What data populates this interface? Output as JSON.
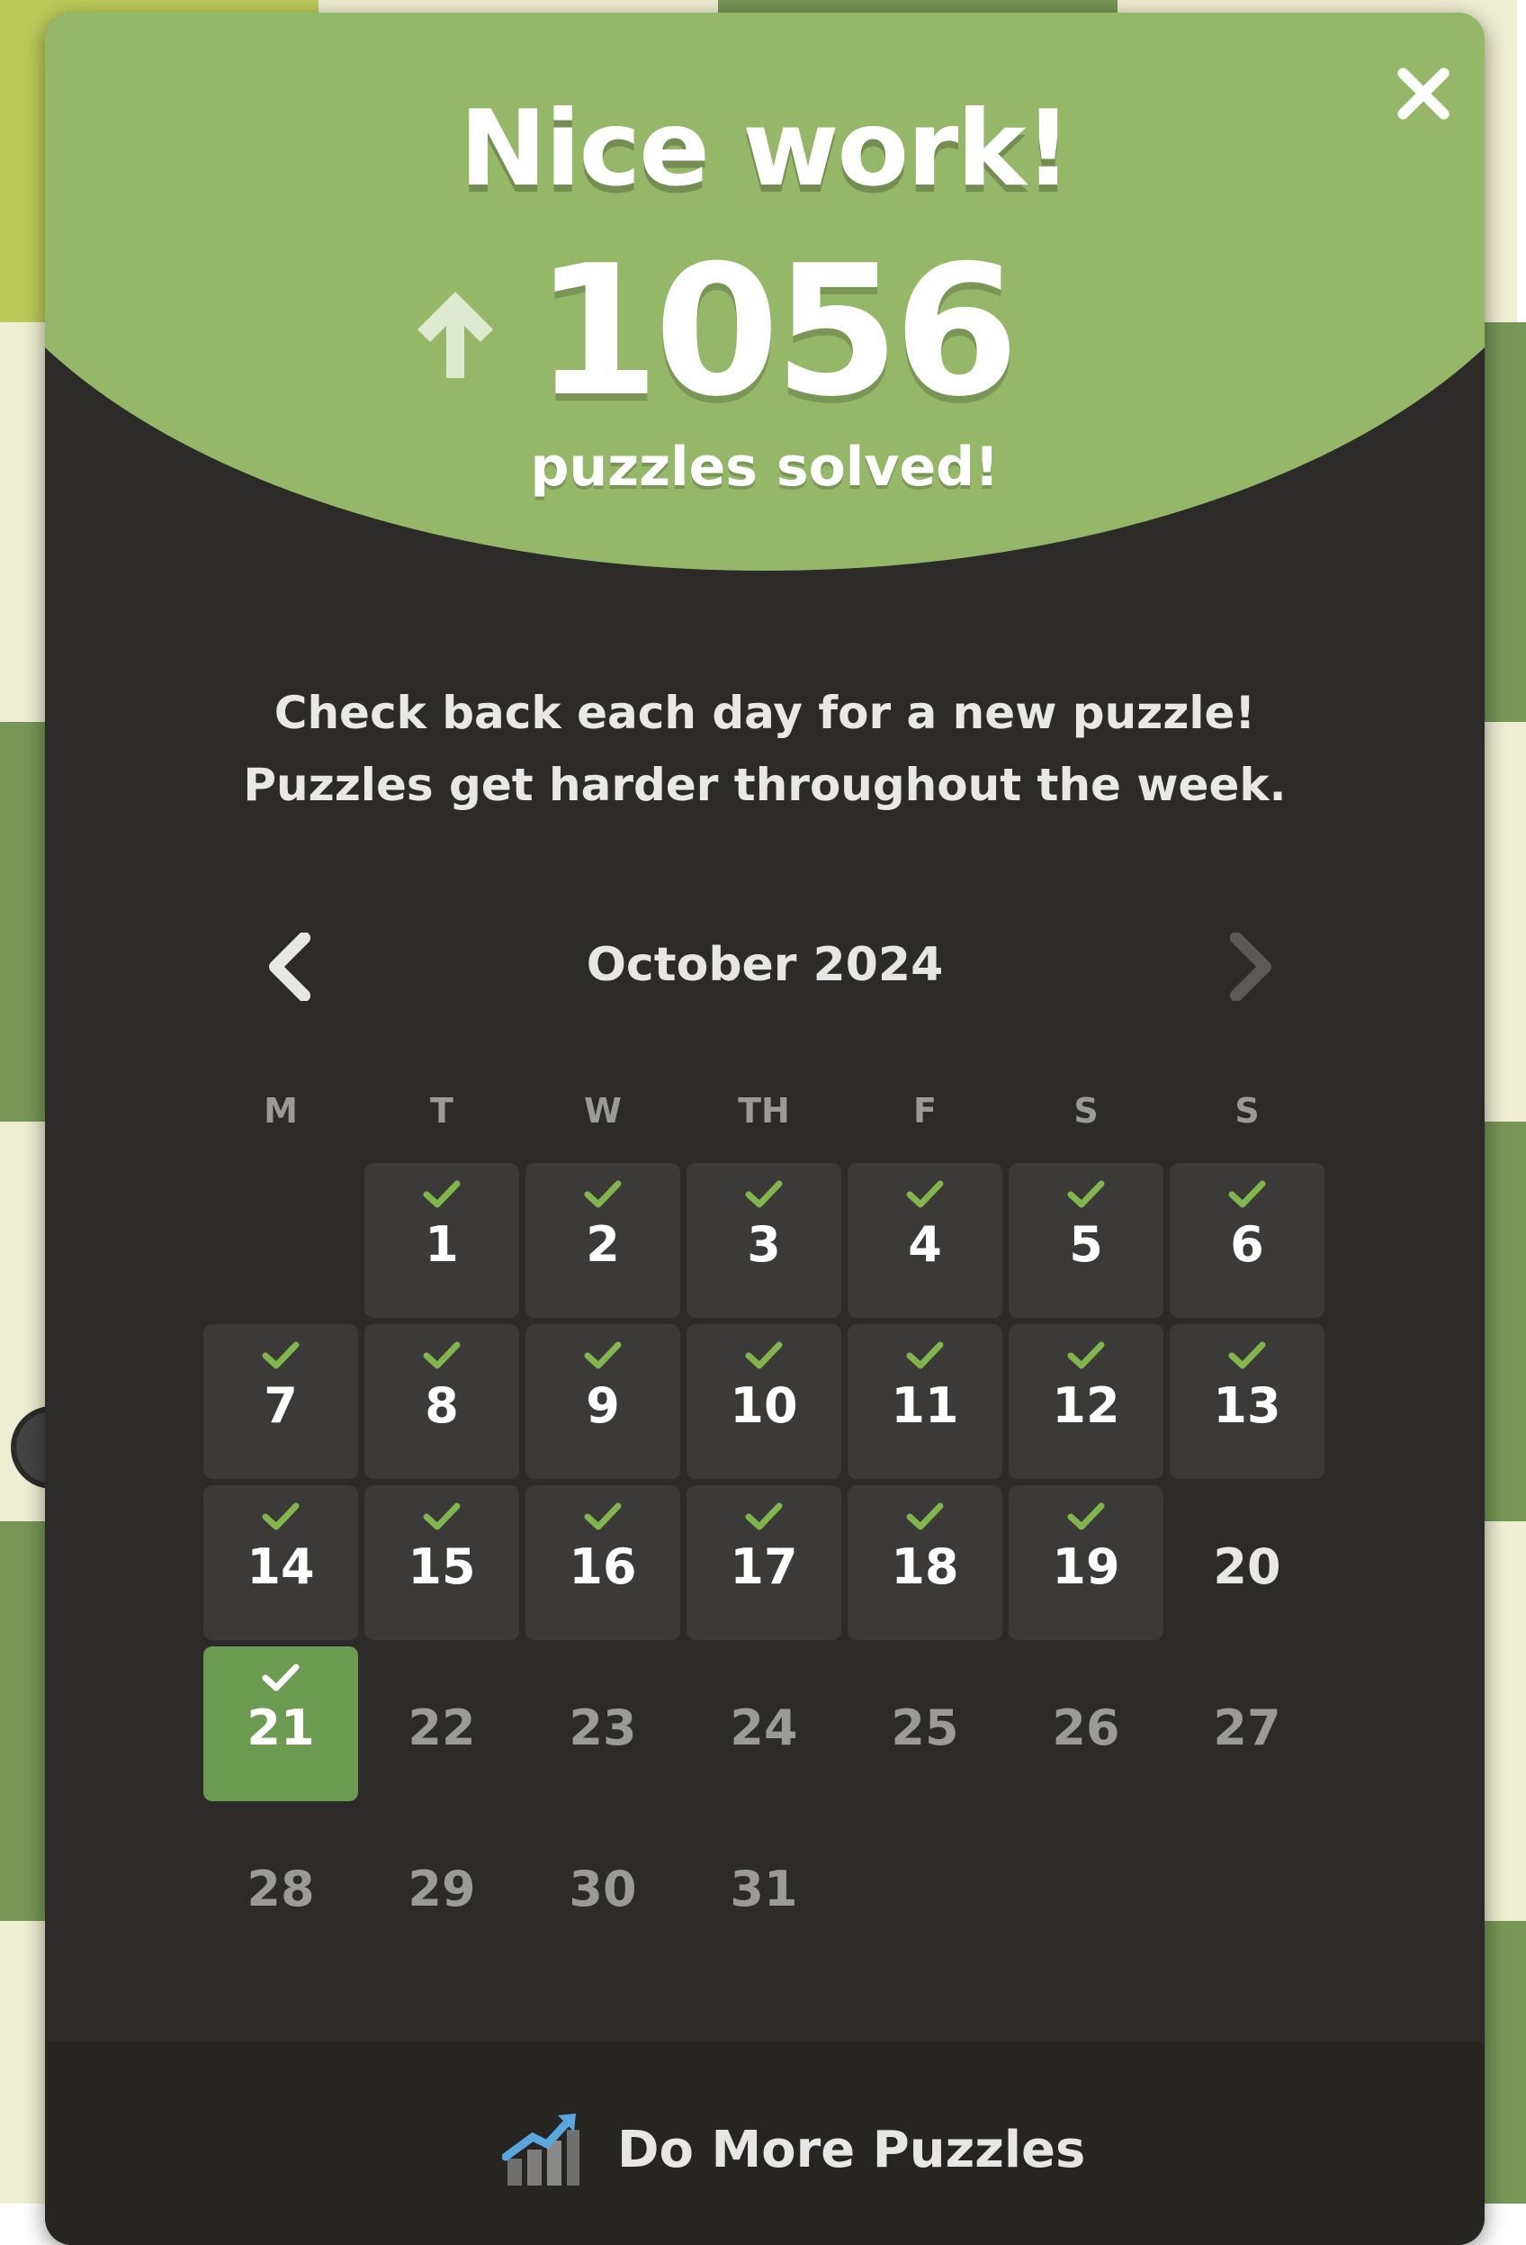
{
  "header": {
    "title": "Nice work!",
    "count": "1056",
    "subtitle": "puzzles solved!"
  },
  "message": {
    "line1": "Check back each day for a new puzzle!",
    "line2": "Puzzles get harder throughout the week."
  },
  "calendar": {
    "month_label": "October 2024",
    "weekdays": [
      "M",
      "T",
      "W",
      "TH",
      "F",
      "S",
      "S"
    ],
    "days": [
      {
        "n": "1",
        "state": "solved"
      },
      {
        "n": "2",
        "state": "solved"
      },
      {
        "n": "3",
        "state": "solved"
      },
      {
        "n": "4",
        "state": "solved"
      },
      {
        "n": "5",
        "state": "solved"
      },
      {
        "n": "6",
        "state": "solved"
      },
      {
        "n": "7",
        "state": "solved"
      },
      {
        "n": "8",
        "state": "solved"
      },
      {
        "n": "9",
        "state": "solved"
      },
      {
        "n": "10",
        "state": "solved"
      },
      {
        "n": "11",
        "state": "solved"
      },
      {
        "n": "12",
        "state": "solved"
      },
      {
        "n": "13",
        "state": "solved"
      },
      {
        "n": "14",
        "state": "solved"
      },
      {
        "n": "15",
        "state": "solved"
      },
      {
        "n": "16",
        "state": "solved"
      },
      {
        "n": "17",
        "state": "solved"
      },
      {
        "n": "18",
        "state": "solved"
      },
      {
        "n": "19",
        "state": "solved"
      },
      {
        "n": "20",
        "state": "open"
      },
      {
        "n": "21",
        "state": "today"
      },
      {
        "n": "22",
        "state": "future"
      },
      {
        "n": "23",
        "state": "future"
      },
      {
        "n": "24",
        "state": "future"
      },
      {
        "n": "25",
        "state": "future"
      },
      {
        "n": "26",
        "state": "future"
      },
      {
        "n": "27",
        "state": "future"
      },
      {
        "n": "28",
        "state": "future"
      },
      {
        "n": "29",
        "state": "future"
      },
      {
        "n": "30",
        "state": "future"
      },
      {
        "n": "31",
        "state": "future"
      }
    ]
  },
  "footer": {
    "button_label": "Do More Puzzles",
    "icon": "chart-up-icon"
  },
  "icons": {
    "close": "close-icon",
    "up_arrow": "arrow-up-icon",
    "prev": "chevron-left-icon",
    "next": "chevron-right-icon",
    "check": "checkmark-icon"
  },
  "colors": {
    "accent_green": "#95b768",
    "today_green": "#6c9a51",
    "check_green": "#81b64c",
    "panel_bg": "#2c2b29",
    "tile_bg": "#3b3a38"
  }
}
